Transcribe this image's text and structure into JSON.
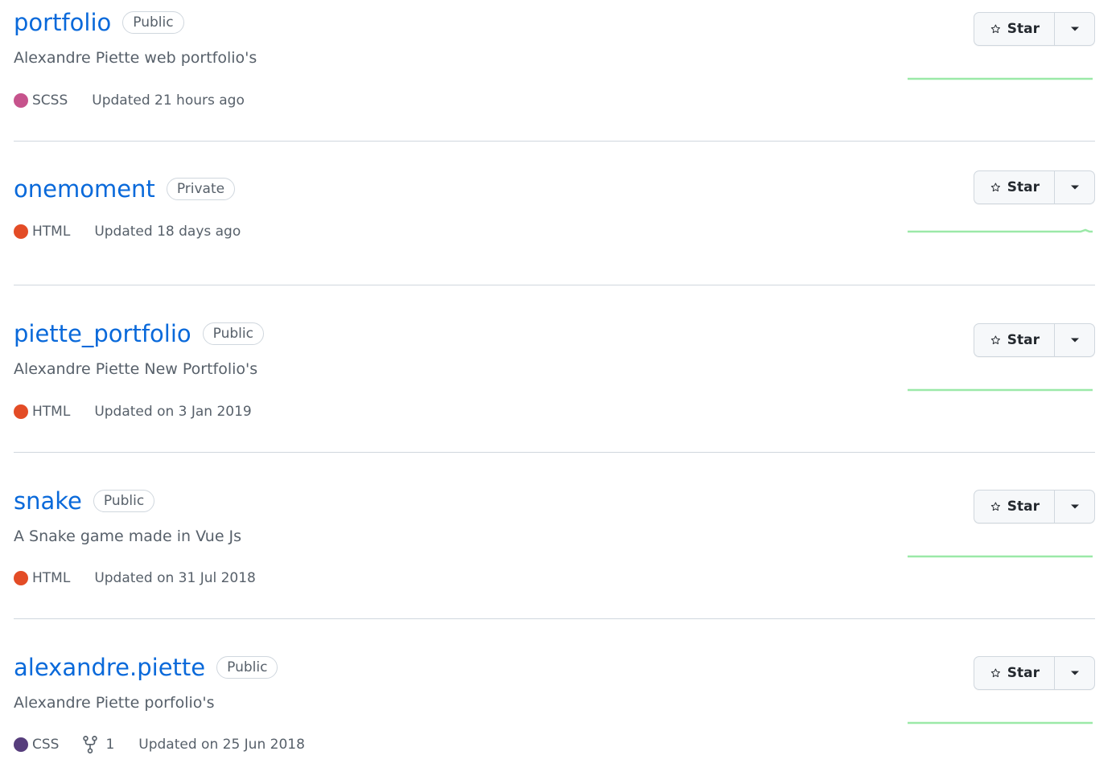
{
  "star_label": "Star",
  "colors": {
    "link": "#0969da",
    "muted": "#57606a",
    "sparkline": "#9be9a8"
  },
  "repos": [
    {
      "name": "portfolio",
      "visibility": "Public",
      "description": "Alexandre Piette web portfolio's",
      "language": "SCSS",
      "language_color": "#c6538c",
      "updated": "Updated 21 hours ago"
    },
    {
      "name": "onemoment",
      "visibility": "Private",
      "description": "",
      "language": "HTML",
      "language_color": "#e34c26",
      "updated": "Updated 18 days ago"
    },
    {
      "name": "piette_portfolio",
      "visibility": "Public",
      "description": "Alexandre Piette New Portfolio's",
      "language": "HTML",
      "language_color": "#e34c26",
      "updated": "Updated on 3 Jan 2019"
    },
    {
      "name": "snake",
      "visibility": "Public",
      "description": "A Snake game made in Vue Js",
      "language": "HTML",
      "language_color": "#e34c26",
      "updated": "Updated on 31 Jul 2018"
    },
    {
      "name": "alexandre.piette",
      "visibility": "Public",
      "description": "Alexandre Piette porfolio's",
      "language": "CSS",
      "language_color": "#563d7c",
      "forks": "1",
      "updated": "Updated on 25 Jun 2018"
    }
  ]
}
